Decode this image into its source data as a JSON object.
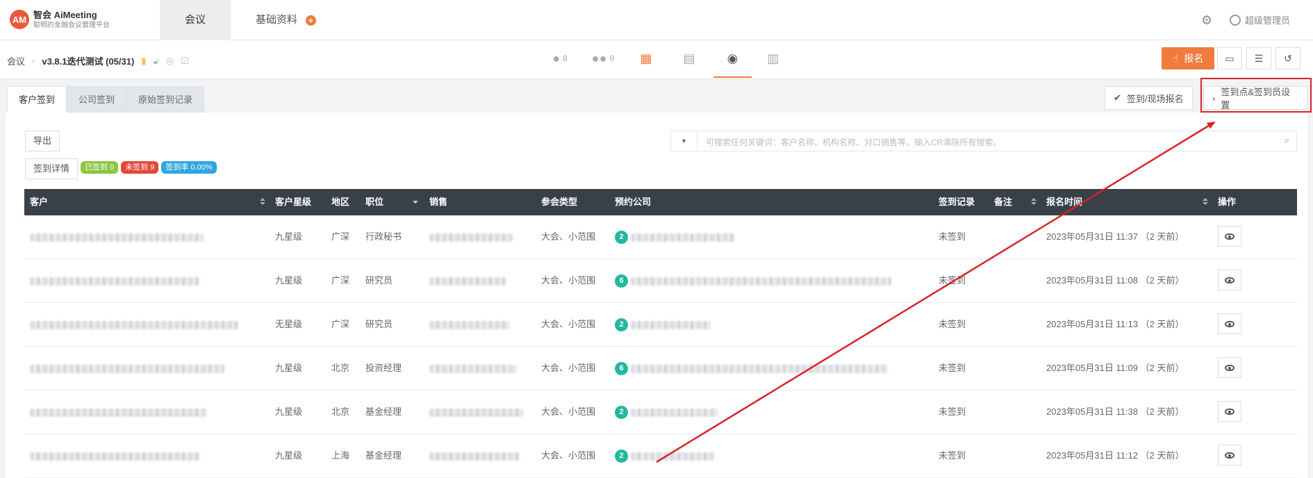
{
  "topbar": {
    "logo_text": "AM",
    "brand_name": "智会 AiMeeting",
    "brand_sub": "聪明的金融会议管理平台",
    "nav": [
      {
        "label": "会议"
      },
      {
        "label": "基础资料"
      }
    ],
    "user_name": "超级管理员",
    "icons": {
      "plus": "plus-circle-icon",
      "settings": "gear-icon",
      "user": "user-icon"
    }
  },
  "subbar": {
    "breadcrumb_root": "会议",
    "meeting_title": "v3.8.1迭代测试 (05/31)",
    "center_tabs": [
      {
        "icon": "person-icon",
        "count": "8"
      },
      {
        "icon": "group-icon",
        "count": "9"
      },
      {
        "icon": "calendar-icon",
        "count": ""
      },
      {
        "icon": "document-icon",
        "count": ""
      },
      {
        "icon": "checkin-icon",
        "count": ""
      },
      {
        "icon": "stats-icon",
        "count": ""
      }
    ],
    "signup_button": "报名"
  },
  "content": {
    "tabs": [
      {
        "label": "客户签到"
      },
      {
        "label": "公司签到"
      },
      {
        "label": "原始签到记录"
      }
    ],
    "checkin_onsite_button": "签到/现场报名",
    "checkin_settings_button": "签到点&签到员设置",
    "export_button": "导出",
    "detail_button": "签到详情",
    "badges": {
      "checked": "已签到 0",
      "unchecked": "未签到 9",
      "rate": "签到率 0.00%"
    },
    "colors": {
      "checked": "#8cc63f",
      "unchecked": "#e5463b",
      "rate": "#2ea7e0",
      "accent": "#f07b3f",
      "highlight": "#d8232a"
    },
    "search_placeholder": "可搜索任何关键词：客户名称、机构名称、对口销售等。输入CR清除所有搜索。"
  },
  "table": {
    "headers": [
      "客户",
      "客户星级",
      "地区",
      "职位",
      "销售",
      "参会类型",
      "预约公司",
      "签到记录",
      "备注",
      "报名时间",
      "操作"
    ],
    "rows": [
      {
        "star": "九星级",
        "region": "广深",
        "position": "行政秘书",
        "type": "大会、小范围",
        "company_count": "2",
        "record": "未签到",
        "time": "2023年05月31日 11:37 （2 天前）"
      },
      {
        "star": "九星级",
        "region": "广深",
        "position": "研究员",
        "type": "大会、小范围",
        "company_count": "6",
        "record": "未签到",
        "time": "2023年05月31日 11:08 （2 天前）"
      },
      {
        "star": "无星级",
        "region": "广深",
        "position": "研究员",
        "type": "大会、小范围",
        "company_count": "2",
        "record": "未签到",
        "time": "2023年05月31日 11:13 （2 天前）"
      },
      {
        "star": "九星级",
        "region": "北京",
        "position": "投资经理",
        "type": "大会、小范围",
        "company_count": "6",
        "record": "未签到",
        "time": "2023年05月31日 11:09 （2 天前）"
      },
      {
        "star": "九星级",
        "region": "北京",
        "position": "基金经理",
        "type": "大会、小范围",
        "company_count": "2",
        "record": "未签到",
        "time": "2023年05月31日 11:38 （2 天前）"
      },
      {
        "star": "九星级",
        "region": "上海",
        "position": "基金经理",
        "type": "大会、小范围",
        "company_count": "2",
        "record": "未签到",
        "time": "2023年05月31日 11:12 （2 天前）"
      }
    ]
  }
}
